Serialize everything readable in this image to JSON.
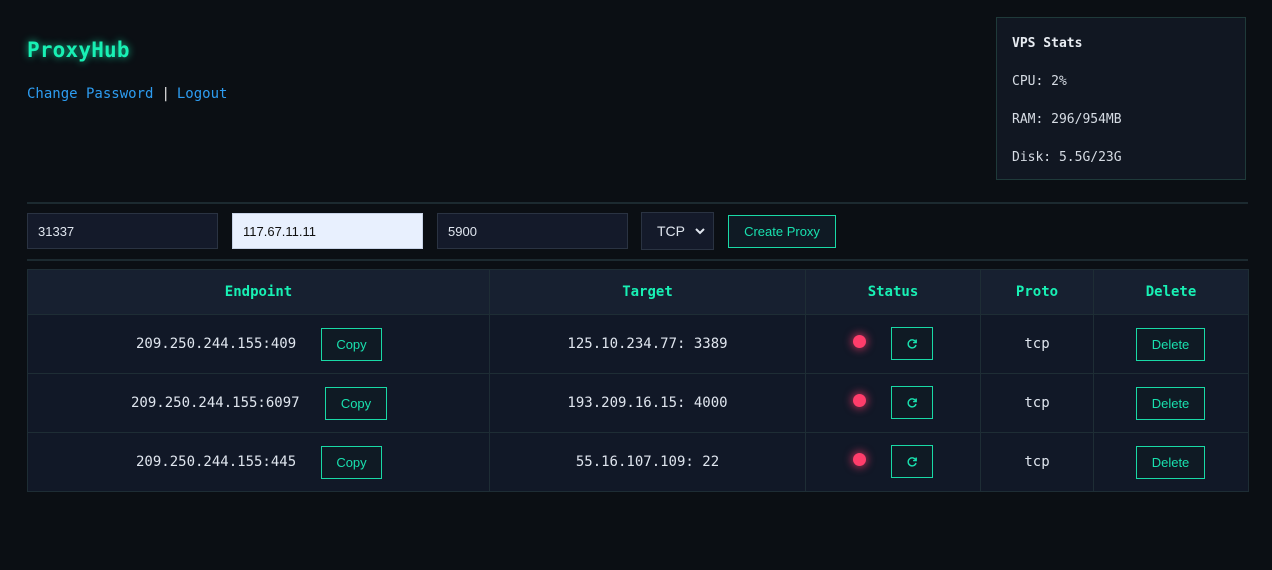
{
  "app": {
    "title": "ProxyHub",
    "change_password": "Change Password",
    "separator": "|",
    "logout": "Logout"
  },
  "stats": {
    "title": "VPS Stats",
    "cpu": "CPU: 2%",
    "ram": "RAM: 296/954MB",
    "disk": "Disk: 5.5G/23G"
  },
  "form": {
    "listen_port": "31337",
    "target_ip": "117.67.11.11",
    "target_port": "5900",
    "protocol": "TCP",
    "create_label": "Create Proxy"
  },
  "table": {
    "headers": [
      "Endpoint",
      "Target",
      "Status",
      "Proto",
      "Delete"
    ],
    "copy_label": "Copy",
    "delete_label": "Delete",
    "refresh_icon": "refresh-icon",
    "status_color": "#ff3d6b",
    "rows": [
      {
        "endpoint": "209.250.244.155:409",
        "target": "125.10.234.77: 3389",
        "proto": "tcp"
      },
      {
        "endpoint": "209.250.244.155:6097",
        "target": "193.209.16.15: 4000",
        "proto": "tcp"
      },
      {
        "endpoint": "209.250.244.155:445",
        "target": "55.16.107.109: 22",
        "proto": "tcp"
      }
    ]
  },
  "colors": {
    "accent": "#18f0b4",
    "link": "#2d9cf0",
    "background": "#0b0f14",
    "status_offline": "#ff3d6b"
  }
}
